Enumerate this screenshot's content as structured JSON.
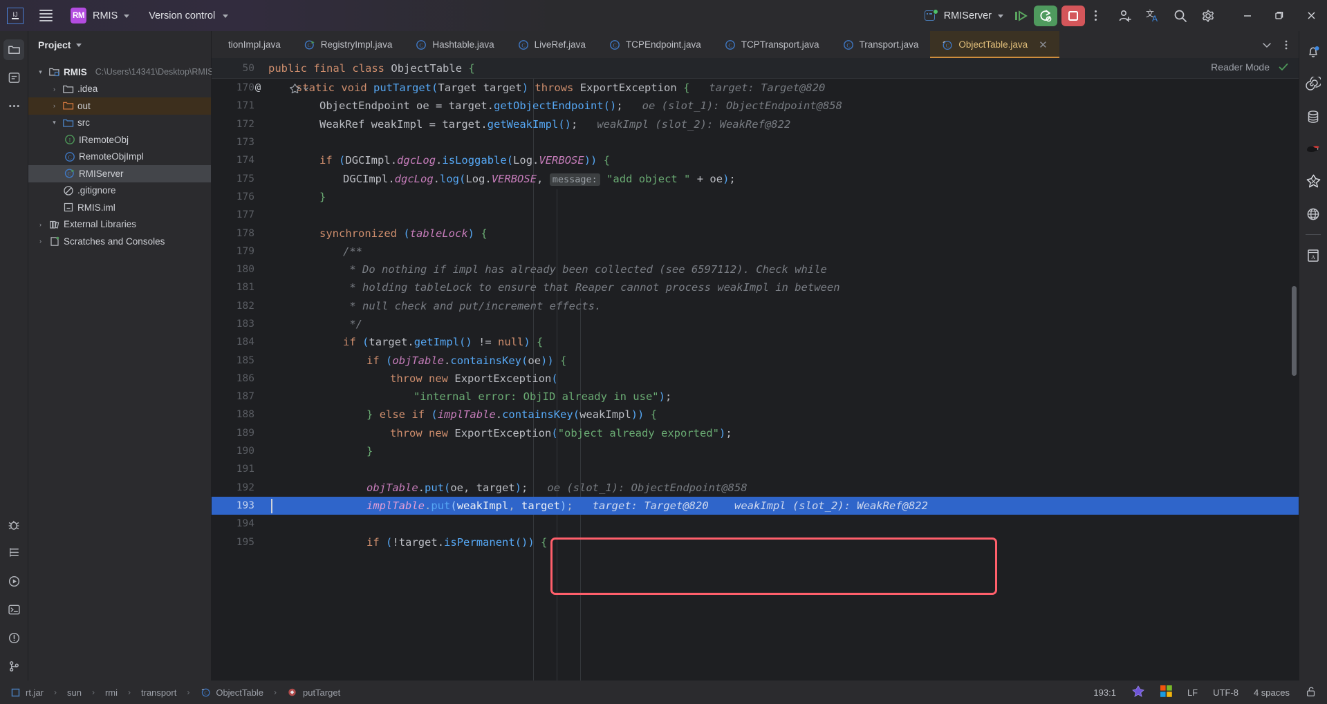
{
  "titlebar": {
    "logo_label": "IJ",
    "project_badge": "RM",
    "project_name": "RMIS",
    "version_control": "Version control",
    "run_config": "RMIServer",
    "icons": {
      "menu": "hamburger-icon",
      "chevron": "chevron-down-icon",
      "run": "run-icon",
      "debug_rerun": "rerun-with-settings-icon",
      "stop": "stop-icon",
      "more": "more-actions-icon",
      "add_user": "add-user-icon",
      "translate": "translate-icon",
      "search": "search-icon",
      "settings": "settings-gear-icon",
      "minimize": "minimize-icon",
      "maximize": "restore-window-icon",
      "close": "close-window-icon"
    }
  },
  "project_panel": {
    "title": "Project",
    "tree": [
      {
        "label": "RMIS",
        "path": "C:\\Users\\14341\\Desktop\\RMIS",
        "indent": 1,
        "arrow": "v",
        "icon": "module-folder-icon",
        "bold": true,
        "state": "none"
      },
      {
        "label": ".idea",
        "path": "",
        "indent": 2,
        "arrow": ">",
        "icon": "folder-grey-icon",
        "bold": false,
        "state": "none"
      },
      {
        "label": "out",
        "path": "",
        "indent": 2,
        "arrow": ">",
        "icon": "folder-orange-icon",
        "bold": false,
        "state": "amber"
      },
      {
        "label": "src",
        "path": "",
        "indent": 2,
        "arrow": "v",
        "icon": "folder-blue-icon",
        "bold": false,
        "state": "none"
      },
      {
        "label": "IRemoteObj",
        "path": "",
        "indent": 3,
        "arrow": "",
        "icon": "interface-icon",
        "bold": false,
        "state": "none"
      },
      {
        "label": "RemoteObjImpl",
        "path": "",
        "indent": 3,
        "arrow": "",
        "icon": "class-icon",
        "bold": false,
        "state": "none"
      },
      {
        "label": "RMIServer",
        "path": "",
        "indent": 3,
        "arrow": "",
        "icon": "runnable-class-icon",
        "bold": false,
        "state": "grey"
      },
      {
        "label": ".gitignore",
        "path": "",
        "indent": 4,
        "arrow": "",
        "icon": "gitignore-icon",
        "bold": false,
        "state": "none"
      },
      {
        "label": "RMIS.iml",
        "path": "",
        "indent": 4,
        "arrow": "",
        "icon": "iml-file-icon",
        "bold": false,
        "state": "none"
      },
      {
        "label": "External Libraries",
        "path": "",
        "indent": 1,
        "arrow": ">",
        "icon": "library-icon",
        "bold": false,
        "state": "none"
      },
      {
        "label": "Scratches and Consoles",
        "path": "",
        "indent": 1,
        "arrow": ">",
        "icon": "scratches-icon",
        "bold": false,
        "state": "none"
      }
    ]
  },
  "left_activity_bar": {
    "items": [
      {
        "name": "project-tool-window",
        "icon": "project-folder-icon",
        "selected": true
      },
      {
        "name": "commit-tool-window",
        "icon": "commit-icon",
        "selected": false
      },
      {
        "name": "more-tool-windows",
        "icon": "more-dots-icon",
        "selected": false
      },
      {
        "name": "debug-tool-window",
        "icon": "debug-bug-icon",
        "selected": false
      },
      {
        "name": "structure-tool-window",
        "icon": "structure-icon",
        "selected": false
      },
      {
        "name": "run-tool-window",
        "icon": "run-play-icon",
        "selected": false
      },
      {
        "name": "terminal-tool-window",
        "icon": "terminal-icon",
        "selected": false
      },
      {
        "name": "problems-tool-window",
        "icon": "problems-icon",
        "selected": false
      },
      {
        "name": "version-control-tool-window",
        "icon": "git-branch-icon",
        "selected": false
      }
    ]
  },
  "right_activity_bar": {
    "items": [
      {
        "name": "notifications",
        "icon": "bell-icon",
        "badge": true
      },
      {
        "name": "ai-assistant",
        "icon": "spiral-icon",
        "badge": false
      },
      {
        "name": "database",
        "icon": "database-icon",
        "badge": false
      },
      {
        "name": "bird-plugin",
        "icon": "bird-icon",
        "badge": false
      },
      {
        "name": "codegeex",
        "icon": "codegeex-icon",
        "badge": false
      },
      {
        "name": "web-preview",
        "icon": "globe-icon",
        "badge": false
      },
      {
        "name": "translation",
        "icon": "dictionary-icon",
        "badge": false
      }
    ]
  },
  "tabs": [
    {
      "label": "tionImpl.java",
      "icon": "class-icon",
      "active": false,
      "truncated": true
    },
    {
      "label": "RegistryImpl.java",
      "icon": "runnable-class-icon",
      "active": false,
      "truncated": false
    },
    {
      "label": "Hashtable.java",
      "icon": "class-icon",
      "active": false,
      "truncated": false
    },
    {
      "label": "LiveRef.java",
      "icon": "class-icon",
      "active": false,
      "truncated": false
    },
    {
      "label": "TCPEndpoint.java",
      "icon": "class-icon",
      "active": false,
      "truncated": false
    },
    {
      "label": "TCPTransport.java",
      "icon": "class-icon",
      "active": false,
      "truncated": false
    },
    {
      "label": "Transport.java",
      "icon": "class-icon",
      "active": false,
      "truncated": false
    },
    {
      "label": "ObjectTable.java",
      "icon": "class-readonly-icon",
      "active": true,
      "truncated": false
    }
  ],
  "tabstrip_controls": {
    "list_tabs": "chevron-down-icon",
    "tab_options": "more-actions-icon"
  },
  "editor": {
    "reader_mode_label": "Reader Mode",
    "reader_mode_check": "checkmark-icon",
    "sticky_line": {
      "num": "50",
      "text": "public final class ObjectTable {"
    },
    "gutter_annotation_line": "170",
    "gutter_annotation_glyph": "@",
    "inspection_hint_icon": "codegeex-inline-icon",
    "highlighted_line": "193",
    "lines": [
      {
        "num": "170",
        "annot": "@",
        "indent": 1,
        "html": "<span class=\"kw\">static</span> <span class=\"kw\">void</span> <span class=\"mth\">putTarget</span><span class=\"paren-p\">(</span><span class=\"typ\">Target</span> <span class=\"ident\">target</span><span class=\"paren-p\">)</span> <span class=\"kw\">throws</span> <span class=\"typ\">ExportException</span> <span class=\"brace-g\">{</span>   <span class=\"hint\">target: Target@820</span>"
      },
      {
        "num": "171",
        "annot": "",
        "indent": 2,
        "html": "<span class=\"typ\">ObjectEndpoint</span> <span class=\"ident\">oe</span> = <span class=\"ident\">target</span>.<span class=\"mth\">getObjectEndpoint</span><span class=\"paren-p\">()</span>;   <span class=\"hint\">oe (slot_1): ObjectEndpoint@858</span>"
      },
      {
        "num": "172",
        "annot": "",
        "indent": 2,
        "html": "<span class=\"typ\">WeakRef</span> <span class=\"ident\">weakImpl</span> = <span class=\"ident\">target</span>.<span class=\"mth\">getWeakImpl</span><span class=\"paren-p\">()</span>;   <span class=\"hint\">weakImpl (slot_2): WeakRef@822</span>"
      },
      {
        "num": "173",
        "annot": "",
        "indent": 0,
        "html": ""
      },
      {
        "num": "174",
        "annot": "",
        "indent": 2,
        "html": "<span class=\"kw\">if</span> <span class=\"paren-p\">(</span><span class=\"typ\">DGCImpl</span>.<span class=\"fld-i\">dgcLog</span>.<span class=\"mth\">isLoggable</span><span class=\"paren-p\">(</span><span class=\"typ\">Log</span>.<span class=\"fld-i\">VERBOSE</span><span class=\"paren-p\">))</span> <span class=\"brace-g\">{</span>"
      },
      {
        "num": "175",
        "annot": "",
        "indent": 3,
        "html": "<span class=\"typ\">DGCImpl</span>.<span class=\"fld-i\">dgcLog</span>.<span class=\"mth\">log</span><span class=\"paren-p\">(</span><span class=\"typ\">Log</span>.<span class=\"fld-i\">VERBOSE</span>, <span class=\"hint-b\">message:</span> <span class=\"str\">\"add object \"</span> + <span class=\"ident\">oe</span><span class=\"paren-p\">)</span>;"
      },
      {
        "num": "176",
        "annot": "",
        "indent": 2,
        "html": "<span class=\"brace-g\">}</span>"
      },
      {
        "num": "177",
        "annot": "",
        "indent": 0,
        "html": ""
      },
      {
        "num": "178",
        "annot": "",
        "indent": 2,
        "html": "<span class=\"kw\">synchronized</span> <span class=\"paren-p\">(</span><span class=\"fld-i\">tableLock</span><span class=\"paren-p\">)</span> <span class=\"brace-g\">{</span>"
      },
      {
        "num": "179",
        "annot": "",
        "indent": 3,
        "html": "<span class=\"cmt\">/**</span>"
      },
      {
        "num": "180",
        "annot": "",
        "indent": 3,
        "html": "<span class=\"cmt\"> * Do nothing if impl has already been collected (see 6597112). Check while</span>"
      },
      {
        "num": "181",
        "annot": "",
        "indent": 3,
        "html": "<span class=\"cmt\"> * holding tableLock to ensure that Reaper cannot process weakImpl in between</span>"
      },
      {
        "num": "182",
        "annot": "",
        "indent": 3,
        "html": "<span class=\"cmt\"> * null check and put/increment effects.</span>"
      },
      {
        "num": "183",
        "annot": "",
        "indent": 3,
        "html": "<span class=\"cmt\"> */</span>"
      },
      {
        "num": "184",
        "annot": "",
        "indent": 3,
        "html": "<span class=\"kw\">if</span> <span class=\"paren-p\">(</span><span class=\"ident\">target</span>.<span class=\"mth\">getImpl</span><span class=\"paren-p\">()</span> != <span class=\"kw\">null</span><span class=\"paren-p\">)</span> <span class=\"brace-g\">{</span>"
      },
      {
        "num": "185",
        "annot": "",
        "indent": 4,
        "html": "<span class=\"kw\">if</span> <span class=\"paren-p\">(</span><span class=\"fld-i\">objTable</span>.<span class=\"mth\">containsKey</span><span class=\"paren-p\">(</span><span class=\"ident\">oe</span><span class=\"paren-p\">))</span> <span class=\"brace-g\">{</span>"
      },
      {
        "num": "186",
        "annot": "",
        "indent": 5,
        "html": "<span class=\"kw\">throw</span> <span class=\"kw\">new</span> <span class=\"typ\">ExportException</span><span class=\"paren-p\">(</span>"
      },
      {
        "num": "187",
        "annot": "",
        "indent": 6,
        "html": "<span class=\"str\">\"internal error: ObjID already in use\"</span><span class=\"paren-p\">)</span>;"
      },
      {
        "num": "188",
        "annot": "",
        "indent": 4,
        "html": "<span class=\"brace-g\">}</span> <span class=\"kw\">else</span> <span class=\"kw\">if</span> <span class=\"paren-p\">(</span><span class=\"fld-i\">implTable</span>.<span class=\"mth\">containsKey</span><span class=\"paren-p\">(</span><span class=\"ident\">weakImpl</span><span class=\"paren-p\">))</span> <span class=\"brace-g\">{</span>"
      },
      {
        "num": "189",
        "annot": "",
        "indent": 5,
        "html": "<span class=\"kw\">throw</span> <span class=\"kw\">new</span> <span class=\"typ\">ExportException</span><span class=\"paren-p\">(</span><span class=\"str\">\"object already exported\"</span><span class=\"paren-p\">)</span>;"
      },
      {
        "num": "190",
        "annot": "",
        "indent": 4,
        "html": "<span class=\"brace-g\">}</span>"
      },
      {
        "num": "191",
        "annot": "",
        "indent": 0,
        "html": ""
      },
      {
        "num": "192",
        "annot": "",
        "indent": 4,
        "html": "<span class=\"fld-i\">objTable</span>.<span class=\"mth\">put</span><span class=\"paren-p\">(</span><span class=\"ident\">oe</span>, <span class=\"ident\">target</span><span class=\"paren-p\">)</span>;   <span class=\"hint\">oe (slot_1): ObjectEndpoint@858</span>"
      },
      {
        "num": "193",
        "annot": "",
        "indent": 4,
        "html": "<span class=\"fld-i\">implTable</span>.<span class=\"mth\">put</span><span class=\"paren-p\">(</span><span class=\"ident\">weakImpl</span>, <span class=\"ident\">target</span><span class=\"paren-p\">)</span>;   <span class=\"hint\">target: Target@820    weakImpl (slot_2): WeakRef@822</span>"
      },
      {
        "num": "194",
        "annot": "",
        "indent": 0,
        "html": ""
      },
      {
        "num": "195",
        "annot": "",
        "indent": 4,
        "html": "<span class=\"kw\">if</span> <span class=\"paren-p\">(</span>!<span class=\"ident\">target</span>.<span class=\"mth\">isPermanent</span><span class=\"paren-p\">())</span> <span class=\"brace-g\">{</span>"
      }
    ]
  },
  "statusbar": {
    "breadcrumb": [
      {
        "label": "rt.jar",
        "icon": "jar-icon"
      },
      {
        "label": "sun",
        "icon": ""
      },
      {
        "label": "rmi",
        "icon": ""
      },
      {
        "label": "transport",
        "icon": ""
      },
      {
        "label": "ObjectTable",
        "icon": "class-readonly-icon"
      },
      {
        "label": "putTarget",
        "icon": "method-icon"
      }
    ],
    "caret_position": "193:1",
    "line_separator": "LF",
    "encoding": "UTF-8",
    "indent": "4 spaces",
    "icons": {
      "codegeex": "codegeex-status-icon",
      "windows": "windows-logo-icon",
      "lock": "unlocked-readonly-icon"
    }
  },
  "colors": {
    "accent_blue": "#4a7ebb",
    "selection_blue": "#2f65ca",
    "annotation_red": "#ff5f6b",
    "active_tab_bg": "#3b3223",
    "active_tab_fg": "#e3c07b",
    "run_green": "#4f9a5e",
    "stop_red": "#d4565a",
    "project_badge": "#b34ce0",
    "editor_bg": "#1e1f22",
    "panel_bg": "#2b2b2e"
  }
}
